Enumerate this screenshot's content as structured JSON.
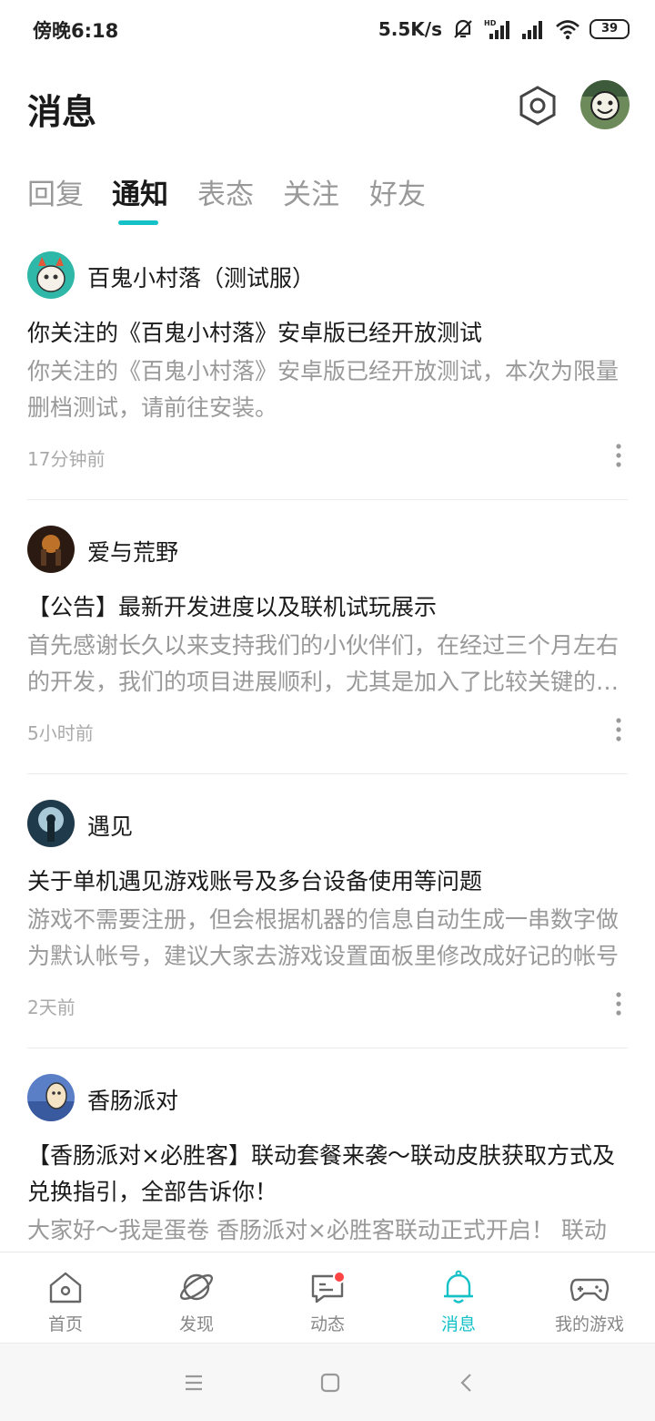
{
  "status_bar": {
    "time": "傍晚6:18",
    "speed": "5.5K/s",
    "battery": "39"
  },
  "header": {
    "title": "消息"
  },
  "tabs": [
    {
      "label": "回复",
      "active": false
    },
    {
      "label": "通知",
      "active": true
    },
    {
      "label": "表态",
      "active": false
    },
    {
      "label": "关注",
      "active": false
    },
    {
      "label": "好友",
      "active": false
    }
  ],
  "notifications": [
    {
      "author": "百鬼小村落（测试服）",
      "title": "你关注的《百鬼小村落》安卓版已经开放测试",
      "body": "你关注的《百鬼小村落》安卓版已经开放测试，本次为限量删档测试，请前往安装。",
      "time": "17分钟前"
    },
    {
      "author": "爱与荒野",
      "title": "【公告】最新开发进度以及联机试玩展示",
      "body": "首先感谢长久以来支持我们的小伙伴们，在经过三个月左右的开发，我们的项目进展顺利，尤其是加入了比较关键的联机功能",
      "time": "5小时前"
    },
    {
      "author": "遇见",
      "title": "关于单机遇见游戏账号及多台设备使用等问题",
      "body": "游戏不需要注册，但会根据机器的信息自动生成一串数字做为默认帐号，建议大家去游戏设置面板里修改成好记的帐号",
      "time": "2天前"
    },
    {
      "author": "香肠派对",
      "title": "【香肠派对×必胜客】联动套餐来袭～联动皮肤获取方式及兑换指引，全部告诉你！",
      "body": "大家好～我是蛋卷 香肠派对×必胜客联动正式开启！ 联动",
      "time": ""
    }
  ],
  "bottom_nav": [
    {
      "label": "首页",
      "icon": "home-icon",
      "active": false
    },
    {
      "label": "发现",
      "icon": "planet-icon",
      "active": false
    },
    {
      "label": "动态",
      "icon": "chat-icon",
      "active": false
    },
    {
      "label": "消息",
      "icon": "bell-icon",
      "active": true
    },
    {
      "label": "我的游戏",
      "icon": "gamepad-icon",
      "active": false
    }
  ],
  "colors": {
    "accent": "#14c1c7",
    "badge": "#ff4444"
  }
}
